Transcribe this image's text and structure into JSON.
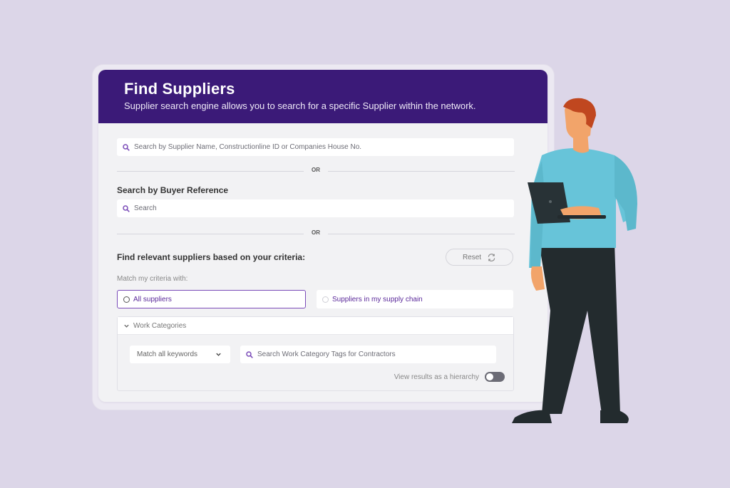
{
  "header": {
    "title": "Find Suppliers",
    "subtitle": "Supplier search engine allows you to search for a specific Supplier within the network."
  },
  "main_search": {
    "placeholder": "Search by Supplier Name, Constructionline ID or Companies House No."
  },
  "divider_text": "OR",
  "buyer_reference": {
    "heading": "Search by Buyer Reference",
    "placeholder": "Search"
  },
  "criteria": {
    "heading": "Find relevant suppliers based on your criteria:",
    "reset_label": "Reset",
    "match_label": "Match my criteria with:",
    "options": [
      {
        "label": "All suppliers",
        "selected": true
      },
      {
        "label": "Suppliers in my supply chain",
        "selected": false
      }
    ]
  },
  "work_categories": {
    "heading": "Work Categories",
    "keyword_select": "Match all keywords",
    "tag_search_placeholder": "Search Work Category Tags for Contractors",
    "hierarchy_label": "View results as a hierarchy",
    "hierarchy_on": false
  },
  "colors": {
    "header_bg": "#3b1a78",
    "accent": "#7a4bb8",
    "page_bg": "#dcd6e8"
  }
}
